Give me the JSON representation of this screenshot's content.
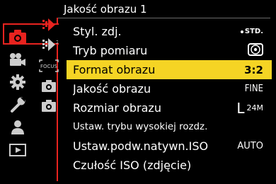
{
  "header": {
    "title": "Jakość obrazu 1"
  },
  "sidebar": {
    "main_items": [
      {
        "icon": "camera-icon",
        "active": true
      },
      {
        "icon": "video-camera-icon",
        "active": false
      },
      {
        "icon": "gear-icon",
        "active": false
      },
      {
        "icon": "wrench-icon",
        "active": false
      },
      {
        "icon": "user-icon",
        "active": false
      },
      {
        "icon": "playback-icon",
        "active": false
      }
    ],
    "sub_items": [
      {
        "icon": "quality-tab-icon-1",
        "active": true
      },
      {
        "icon": "quality-tab-icon-2",
        "active": false
      },
      {
        "icon": "focus-tab-icon",
        "label": "FOCUS",
        "active": false
      },
      {
        "icon": "camera-tab-icon",
        "active": false
      },
      {
        "icon": "camera-tab-icon-2",
        "active": false
      }
    ]
  },
  "menu": {
    "items": [
      {
        "label": "Styl. zdj.",
        "value": "STD."
      },
      {
        "label": "Tryb pomiaru",
        "value": ""
      },
      {
        "label": "Format obrazu",
        "value": "3:2",
        "selected": true
      },
      {
        "label": "Jakość obrazu",
        "value": "FINE"
      },
      {
        "label": "Rozmiar obrazu",
        "value": "L",
        "value_sub": "24M"
      },
      {
        "label": "Ustaw. trybu wysokiej rozdz.",
        "value": ""
      },
      {
        "label": "Ustaw.podw.natywn.ISO",
        "value": "AUTO"
      },
      {
        "label": "Czułość ISO (zdjęcie)",
        "value": ""
      }
    ]
  },
  "colors": {
    "accent_red": "#e8231f",
    "selection_yellow": "#f5d424"
  }
}
